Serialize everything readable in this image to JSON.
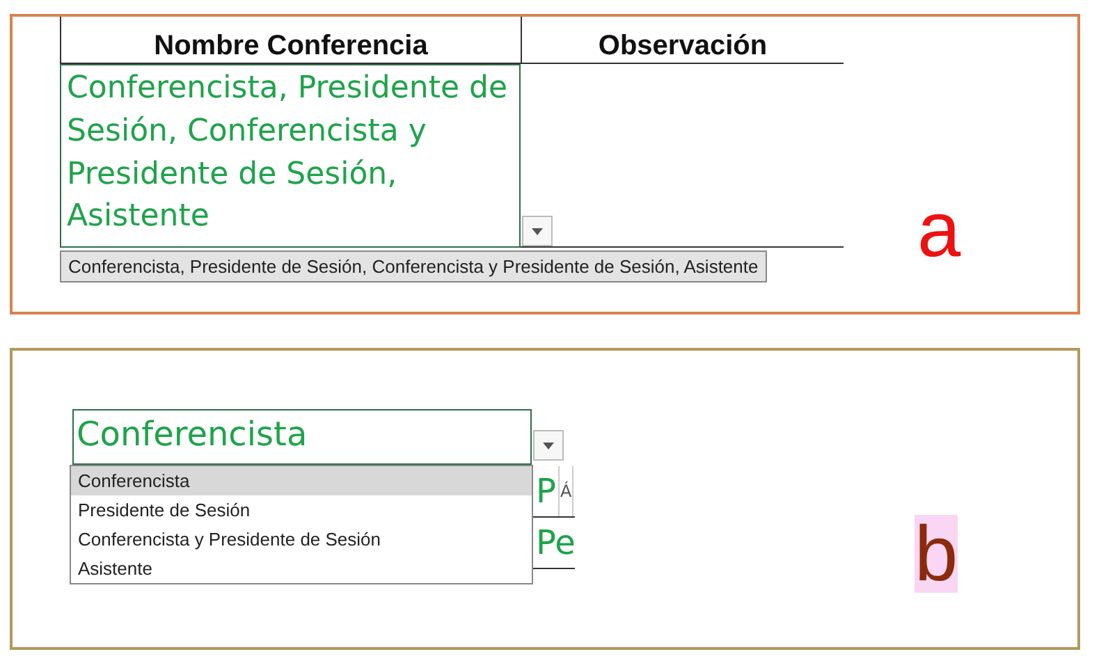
{
  "panel_a": {
    "letter": "a",
    "headers": [
      "Nombre Conferencia",
      "Observación"
    ],
    "cell_value": "Conferencista, Presidente de Sesión, Conferencista y Presidente de Sesión, Asistente",
    "list_items": [
      {
        "label": "Conferencista, Presidente de Sesión, Conferencista y Presidente de Sesión, Asistente",
        "selected": true
      }
    ]
  },
  "panel_b": {
    "letter": "b",
    "cell_value": "Conferencista",
    "list_items": [
      {
        "label": "Conferencista",
        "selected": true
      },
      {
        "label": "Presidente de Sesión",
        "selected": false
      },
      {
        "label": "Conferencista y Presidente de Sesión",
        "selected": false
      },
      {
        "label": "Asistente",
        "selected": false
      }
    ],
    "side_cells": [
      {
        "text": "P",
        "note": "Á"
      },
      {
        "text": "Pe"
      }
    ]
  }
}
